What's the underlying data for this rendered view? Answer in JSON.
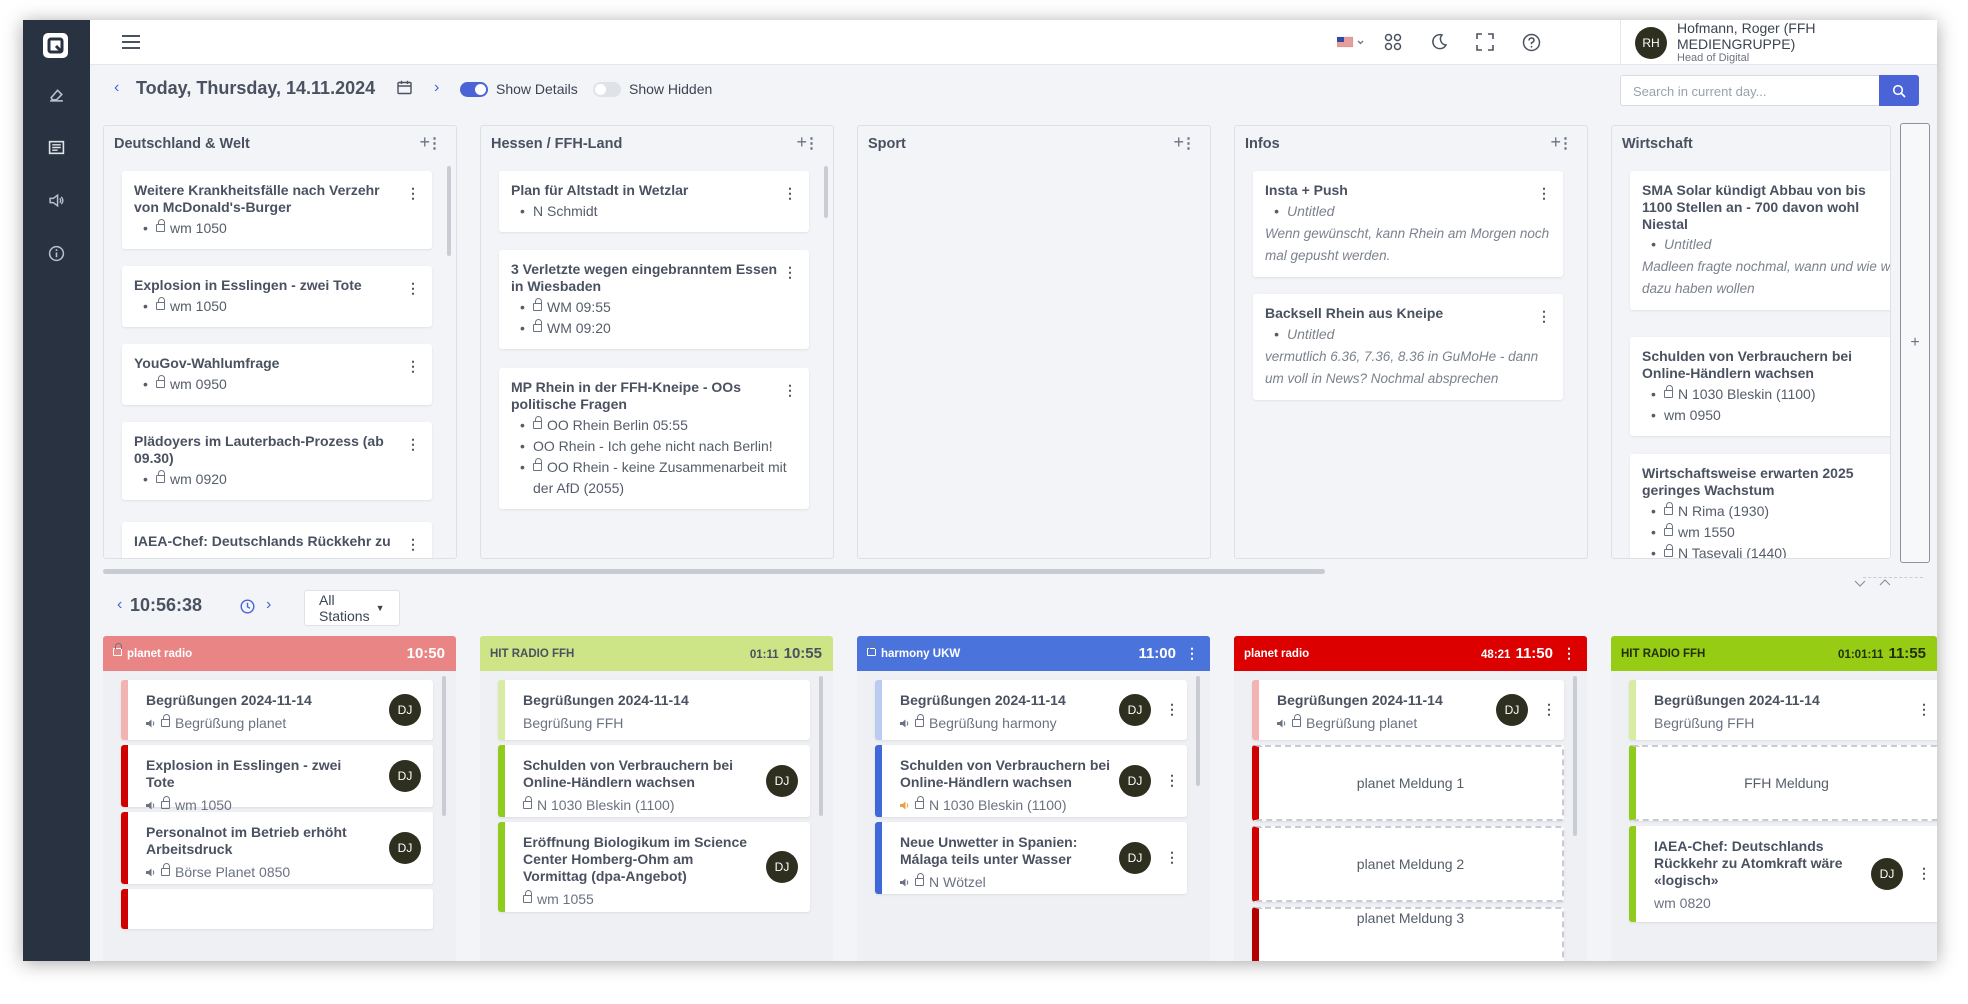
{
  "header": {
    "user_initials": "RH",
    "user_name": "Hofmann, Roger (FFH MEDIENGRUPPE)",
    "user_role": "Head of Digital"
  },
  "daybar": {
    "date_title": "Today, Thursday, 14.11.2024",
    "show_details": "Show Details",
    "show_hidden": "Show Hidden",
    "search_placeholder": "Search in current day..."
  },
  "columns": [
    {
      "title": "Deutschland & Welt",
      "cards": [
        {
          "title": "Weitere Krankheitsfälle nach Verzehr von McDonald's-Burger",
          "items": [
            {
              "text": "wm 1050",
              "lock": true
            }
          ]
        },
        {
          "title": "Explosion in Esslingen - zwei Tote",
          "items": [
            {
              "text": "wm 1050",
              "lock": true
            }
          ]
        },
        {
          "title": "YouGov-Wahlumfrage",
          "items": [
            {
              "text": "wm 0950",
              "lock": true
            }
          ]
        },
        {
          "title": "Plädoyers im Lauterbach-Prozess (ab 09.30)",
          "items": [
            {
              "text": "wm 0920",
              "lock": true
            }
          ]
        },
        {
          "title": "IAEA-Chef: Deutschlands Rückkehr zu",
          "items": []
        }
      ]
    },
    {
      "title": "Hessen / FFH-Land",
      "cards": [
        {
          "title": "Plan für Altstadt in Wetzlar",
          "items": [
            {
              "text": "N Schmidt",
              "lock": false
            }
          ]
        },
        {
          "title": "3 Verletzte wegen eingebranntem Essen in Wiesbaden",
          "items": [
            {
              "text": "WM 09:55",
              "lock": true
            },
            {
              "text": "WM 09:20",
              "lock": true
            }
          ]
        },
        {
          "title": "MP Rhein in der FFH-Kneipe - OOs politische Fragen",
          "items": [
            {
              "text": "OO Rhein Berlin 05:55",
              "lock": true
            },
            {
              "text": "OO Rhein - Ich gehe nicht nach Berlin!",
              "lock": false
            },
            {
              "text": "OO Rhein - keine Zusammenarbeit mit der AfD (2055)",
              "lock": true
            }
          ]
        }
      ]
    },
    {
      "title": "Sport",
      "cards": []
    },
    {
      "title": "Infos",
      "cards": [
        {
          "title": "Insta + Push",
          "items": [
            {
              "text": "Untitled",
              "lock": false,
              "italic": true
            }
          ],
          "note": "Wenn gewünscht, kann Rhein am Morgen noch mal gepusht werden."
        },
        {
          "title": "Backsell Rhein aus Kneipe",
          "items": [
            {
              "text": "Untitled",
              "lock": false,
              "italic": true
            }
          ],
          "note": "vermutlich 6.36, 7.36, 8.36 in GuMoHe - dann um voll in News? Nochmal absprechen"
        }
      ]
    },
    {
      "title": "Wirtschaft",
      "cards": [
        {
          "title": "SMA Solar kündigt Abbau von bis 1100 Stellen an - 700 davon wohl Niestal",
          "items": [
            {
              "text": "Untitled",
              "lock": false,
              "italic": true
            }
          ],
          "note": "Madleen fragte nochmal, wann und wie wir dazu haben wollen"
        },
        {
          "title": "Schulden von Verbrauchern bei Online-Händlern wachsen",
          "items": [
            {
              "text": "N 1030 Bleskin (1100)",
              "lock": true
            },
            {
              "text": "wm 0950",
              "lock": false
            }
          ]
        },
        {
          "title": "Wirtschaftsweise erwarten 2025 geringes Wachstum",
          "items": [
            {
              "text": "N Rima (1930)",
              "lock": true
            },
            {
              "text": "wm 1550",
              "lock": true
            },
            {
              "text": "N Tasevali (1440)",
              "lock": true
            }
          ]
        }
      ]
    }
  ],
  "add_column": "+",
  "timebar": {
    "clock": "10:56:38",
    "stations_filter": "All Stations"
  },
  "stations": [
    {
      "name": "planet radio",
      "duration": "",
      "time": "10:50",
      "lock": true,
      "head_color": "#e98585",
      "text_color": "#ffffff",
      "items": [
        {
          "title": "Begrüßungen 2024-11-14",
          "sub": "Begrüßung planet",
          "speaker": true,
          "lock": true,
          "avatar": "DJ",
          "bar": "#f3b3b3"
        },
        {
          "title": "Explosion in Esslingen - zwei Tote",
          "sub": "wm 1050",
          "speaker": true,
          "lock": true,
          "avatar": "DJ",
          "bar": "#d10000"
        },
        {
          "title": "Personalnot im Betrieb erhöht Arbeitsdruck",
          "sub": "Börse Planet 0850",
          "speaker": true,
          "lock": true,
          "avatar": "DJ",
          "bar": "#d10000"
        }
      ]
    },
    {
      "name": "HIT RADIO FFH",
      "duration": "01:11",
      "time": "10:55",
      "lock": false,
      "head_color": "#cde487",
      "text_color": "#4a5160",
      "items": [
        {
          "title": "Begrüßungen 2024-11-14",
          "sub": "Begrüßung FFH",
          "speaker": false,
          "lock": false,
          "avatar": "",
          "bar": "#d9eca4"
        },
        {
          "title": "Schulden von Verbrauchern bei Online-Händlern wachsen",
          "sub": "N 1030 Bleskin (1100)",
          "speaker": false,
          "lock": true,
          "avatar": "DJ",
          "bar": "#8fcc1e"
        },
        {
          "title": "Eröffnung Biologikum im Science Center Homberg-Ohm am Vormittag (dpa-Angebot)",
          "sub": "wm 1055",
          "speaker": false,
          "lock": true,
          "avatar": "DJ",
          "bar": "#8fcc1e"
        }
      ]
    },
    {
      "name": "harmony UKW",
      "duration": "",
      "time": "11:00",
      "lock": true,
      "head_color": "#4a73dc",
      "text_color": "#ffffff",
      "items": [
        {
          "title": "Begrüßungen 2024-11-14",
          "sub": "Begrüßung harmony",
          "speaker": true,
          "lock": true,
          "avatar": "DJ",
          "bar": "#bccbf2"
        },
        {
          "title": "Schulden von Verbrauchern bei Online-Händlern wachsen",
          "sub": "N 1030 Bleskin (1100)",
          "speaker": true,
          "lock": true,
          "avatar": "DJ",
          "bar": "#3f68d8",
          "speaker_color": "#e8a33a"
        },
        {
          "title": "Neue Unwetter in Spanien: Málaga teils unter Wasser",
          "sub": "N Wötzel",
          "speaker": true,
          "lock": true,
          "avatar": "DJ",
          "bar": "#3f68d8"
        }
      ]
    },
    {
      "name": "planet radio",
      "duration": "48:21",
      "time": "11:50",
      "lock": false,
      "head_color": "#dc0000",
      "text_color": "#ffffff",
      "items": [
        {
          "title": "Begrüßungen 2024-11-14",
          "sub": "Begrüßung planet",
          "speaker": true,
          "lock": true,
          "avatar": "DJ",
          "bar": "#f3b3b3"
        },
        {
          "placeholder": "planet Meldung 1",
          "bar": "#d10000"
        },
        {
          "placeholder": "planet Meldung 2",
          "bar": "#d10000"
        },
        {
          "placeholder": "planet Meldung 3",
          "bar": "#b30000"
        }
      ]
    },
    {
      "name": "HIT RADIO FFH",
      "duration": "01:01:11",
      "time": "11:55",
      "lock": false,
      "head_color": "#96cc14",
      "text_color": "#22300a",
      "items": [
        {
          "title": "Begrüßungen 2024-11-14",
          "sub": "Begrüßung FFH",
          "speaker": false,
          "lock": false,
          "avatar": "",
          "bar": "#d9eca4"
        },
        {
          "placeholder": "FFH Meldung",
          "bar": "#8fcc1e"
        },
        {
          "title": "IAEA-Chef: Deutschlands Rückkehr zu Atomkraft wäre «logisch»",
          "sub": "wm 0820",
          "speaker": false,
          "lock": false,
          "avatar": "DJ",
          "bar": "#8fcc1e"
        }
      ]
    }
  ]
}
